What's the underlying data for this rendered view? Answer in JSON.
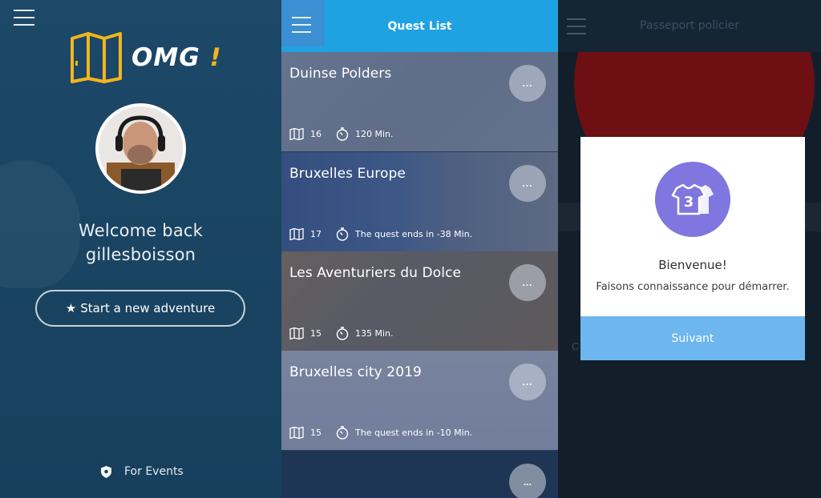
{
  "left_panel": {
    "logo_text": "OMG",
    "logo_bang": "!",
    "welcome_line1": "Welcome back",
    "welcome_line2": "gillesboisson",
    "start_button": "Start a new adventure",
    "events_label": "For Events",
    "icons": [
      "menu-icon",
      "map-door-logo-icon",
      "star-icon",
      "shield-icon"
    ]
  },
  "middle_panel": {
    "title": "Quest List",
    "more_label": "...",
    "quests": [
      {
        "name": "Duinse Polders",
        "count": "16",
        "time": "120 Min."
      },
      {
        "name": "Bruxelles Europe",
        "count": "17",
        "time": "The quest ends in -38 Min."
      },
      {
        "name": "Les Aventuriers du Dolce",
        "count": "15",
        "time": "135 Min."
      },
      {
        "name": "Bruxelles city 2019",
        "count": "15",
        "time": "The quest ends in -10 Min."
      }
    ]
  },
  "right_panel": {
    "title": "Passeport policier",
    "dim_letter": "C",
    "modal": {
      "badge_number": "3",
      "title": "Bienvenue!",
      "subtitle": "Faisons connaissance pour démarrer.",
      "button": "Suivant"
    }
  },
  "colors": {
    "left_bg": "#1d4868",
    "header_blue": "#1fa2e2",
    "menu_box": "#3b8fd2",
    "modal_badge": "#7f76df",
    "modal_button": "#6db6ee",
    "logo_accent": "#f3b51c"
  }
}
